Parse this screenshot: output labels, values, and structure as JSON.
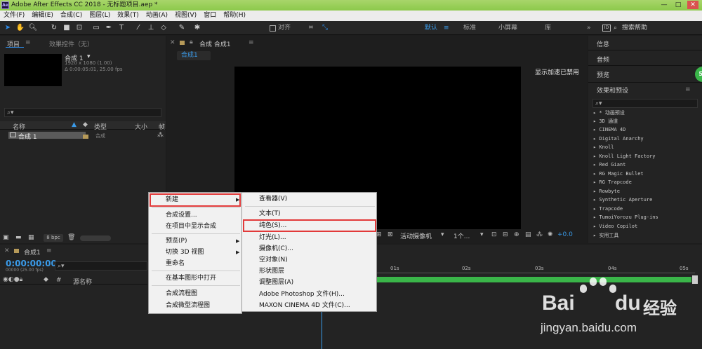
{
  "app": {
    "title": "Adobe After Effects CC 2018 - 无标题项目.aep *",
    "logo_text": "Ae"
  },
  "menubar": [
    "文件(F)",
    "编辑(E)",
    "合成(C)",
    "图层(L)",
    "效果(T)",
    "动画(A)",
    "视图(V)",
    "窗口",
    "帮助(H)"
  ],
  "toolbar": {
    "align_label": "对齐",
    "workspaces": [
      "默认",
      "标准",
      "小屏幕",
      "库"
    ],
    "search_placeholder": "搜索帮助"
  },
  "project": {
    "tab": "项目",
    "effects_tab": "效果控件（无）",
    "comp_name": "合成 1",
    "comp_size": "1920 x 1080 (1.00)",
    "comp_duration": "Δ 0:00:05:01, 25.00 fps",
    "columns": [
      "名称",
      "类型",
      "大小",
      "帧"
    ],
    "row_name": "合成 1",
    "row_type": "合成",
    "bpc": "8 bpc"
  },
  "viewer": {
    "tab_title": "合成 合成1",
    "sub_tab": "合成1",
    "gpu_notice": "显示加速已禁用",
    "camera": "活动摄像机",
    "views": "1个...",
    "offset": "+0.0"
  },
  "right_panel": {
    "items": [
      "信息",
      "音频",
      "预览",
      "效果和预设"
    ],
    "effects": [
      "▸ * 动画预设",
      "▸ 3D 通道",
      "▸ CINEMA 4D",
      "▸ Digital Anarchy",
      "▸ Knoll",
      "▸ Knoll Light Factory",
      "▸ Red Giant",
      "▸ RG Magic Bullet",
      "▸ RG Trapcode",
      "▸ Rowbyte",
      "▸ Synthetic Aperture",
      "▸ Trapcode",
      "▸ TumoiYorozu Plug-ins",
      "▸ Video Copilot",
      "▸ 实用工具"
    ]
  },
  "timeline": {
    "tab": "合成1",
    "timecode": "0:00:00:00",
    "frames": "00000 (25.00 fps)",
    "source_col": "源名称",
    "ticks": [
      "01s",
      "02s",
      "03s",
      "04s",
      "05s"
    ]
  },
  "context_menu": {
    "items": [
      "新建",
      "合成设置...",
      "在项目中显示合成",
      "预览(P)",
      "切换 3D 视图",
      "重命名",
      "在基本图形中打开",
      "合成流程图",
      "合成微型流程图"
    ]
  },
  "submenu": {
    "items": [
      "查看器(V)",
      "文本(T)",
      "纯色(S)...",
      "灯光(L)...",
      "摄像机(C)...",
      "空对象(N)",
      "形状图层",
      "调整图层(A)",
      "Adobe Photoshop 文件(H)...",
      "MAXON CINEMA 4D 文件(C)..."
    ]
  },
  "watermark": {
    "brand": "Bai",
    "brand2": "du",
    "cn": "经验",
    "url": "jingyan.baidu.com"
  },
  "badge": "54"
}
